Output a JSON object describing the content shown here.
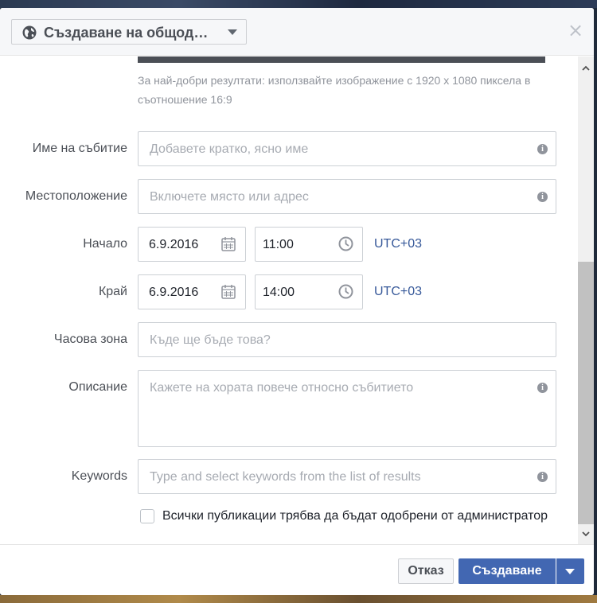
{
  "header": {
    "audience_label": "Създаване на общод…",
    "close_symbol": "×"
  },
  "image_hint": "За най-добри резултати: използвайте изображение с 1920 х 1080 пиксела в съотношение 16:9",
  "form": {
    "event_name": {
      "label": "Име на събитие",
      "placeholder": "Добавете кратко, ясно име"
    },
    "location": {
      "label": "Местоположение",
      "placeholder": "Включете място или адрес"
    },
    "start": {
      "label": "Начало",
      "date": "6.9.2016",
      "time": "11:00",
      "timezone": "UTC+03"
    },
    "end": {
      "label": "Край",
      "date": "6.9.2016",
      "time": "14:00",
      "timezone": "UTC+03"
    },
    "time_zone": {
      "label": "Часова зона",
      "placeholder": "Къде ще бъде това?"
    },
    "description": {
      "label": "Описание",
      "placeholder": "Кажете на хората повече относно събитието"
    },
    "keywords": {
      "label": "Keywords",
      "placeholder": "Type and select keywords from the list of results"
    },
    "admin_approval": {
      "label": "Всички публикации трябва да бъдат одобрени от администратор",
      "checked": false
    }
  },
  "footer": {
    "cancel_label": "Отказ",
    "create_label": "Създаване"
  },
  "icons": {
    "globe": "globe-icon",
    "info": "info-icon",
    "calendar": "calendar-icon",
    "clock": "clock-icon"
  },
  "colors": {
    "primary": "#4267b2",
    "link": "#365899",
    "header_bg": "#f6f7f9"
  }
}
